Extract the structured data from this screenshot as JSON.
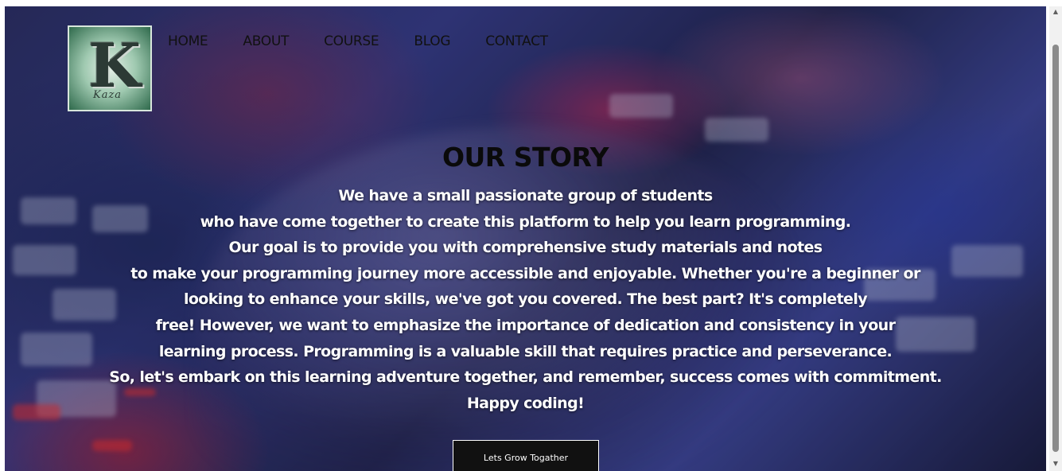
{
  "logo": {
    "letter": "K",
    "script": "Kaza"
  },
  "nav": {
    "items": [
      {
        "label": "HOME"
      },
      {
        "label": "ABOUT"
      },
      {
        "label": "COURSE"
      },
      {
        "label": "BLOG"
      },
      {
        "label": "CONTACT"
      }
    ]
  },
  "story": {
    "title": "OUR STORY",
    "lines": [
      "We have a small passionate group of students",
      "who have come together to create this platform to help you learn programming.",
      "Our goal is to provide you with comprehensive study materials and notes",
      "to make your programming journey more accessible and enjoyable. Whether you're a beginner or",
      "looking to enhance your skills, we've got you covered. The best part? It's completely",
      "free! However, we want to emphasize the importance of dedication and consistency in your",
      "learning process. Programming is a valuable skill that requires practice and perseverance.",
      "So, let's embark on this learning adventure together, and remember, success comes with commitment.",
      "Happy coding!"
    ],
    "cta_label": "Lets Grow Togather"
  },
  "scrollbar": {
    "up_icon": "▲",
    "down_icon": "▼"
  },
  "colors": {
    "nav_text": "#111111",
    "title_text": "#0a0a0a",
    "body_text": "#ffffff",
    "button_bg": "#111111",
    "button_border": "#ffffff"
  }
}
